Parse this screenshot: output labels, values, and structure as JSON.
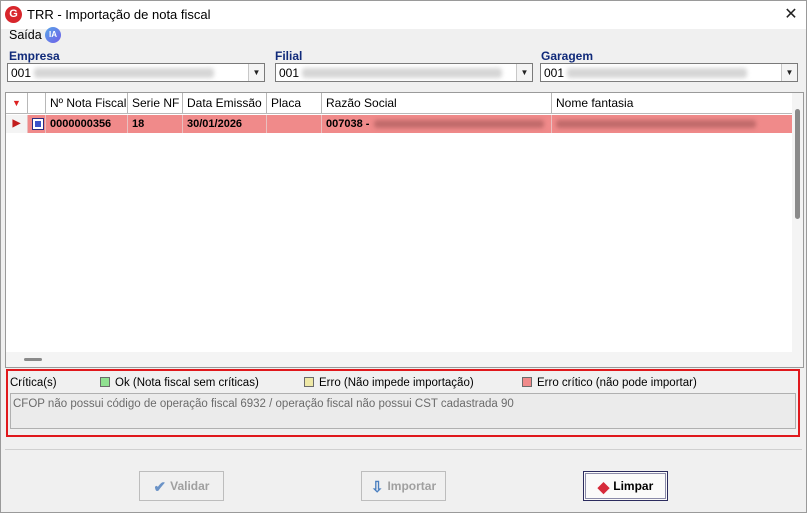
{
  "window": {
    "title": "TRR - Importação de nota fiscal",
    "app_icon_letter": "G",
    "close_glyph": "✕"
  },
  "menu": {
    "label": "Saída",
    "ia_badge": "IA"
  },
  "filters": {
    "empresa": {
      "label": "Empresa",
      "value": "001"
    },
    "filial": {
      "label": "Filial",
      "value": "001"
    },
    "garagem": {
      "label": "Garagem",
      "value": "001"
    }
  },
  "grid": {
    "columns": [
      "Nº Nota Fiscal",
      "Serie NF",
      "Data Emissão",
      "Placa",
      "Razão Social",
      "Nome fantasia"
    ],
    "rows": [
      {
        "nota": "0000000356",
        "serie": "18",
        "data": "30/01/2026",
        "placa": "",
        "razao": "007038 -",
        "fantasia": ""
      }
    ],
    "row_color": "#f08a8a"
  },
  "criticas": {
    "label": "Crítica(s)",
    "legend": [
      {
        "label": "Ok (Nota fiscal sem críticas)",
        "color": "#90e090"
      },
      {
        "label": "Erro (Não impede importação)",
        "color": "#eee8a6"
      },
      {
        "label": "Erro crítico (não pode importar)",
        "color": "#f08a8a"
      }
    ],
    "message": "CFOP não possui código de operação fiscal 6932  / operação fiscal não possui CST cadastrada 90"
  },
  "buttons": {
    "validar": {
      "label": "Validar",
      "enabled": false
    },
    "importar": {
      "label": "Importar",
      "enabled": false
    },
    "limpar": {
      "label": "Limpar",
      "enabled": true
    }
  },
  "icons": [
    "app-logo-icon",
    "close-icon",
    "ia-icon",
    "dropdown-arrow-icon",
    "sort-arrow-icon",
    "row-pointer-icon",
    "document-icon",
    "check-icon",
    "import-icon",
    "eraser-icon"
  ]
}
